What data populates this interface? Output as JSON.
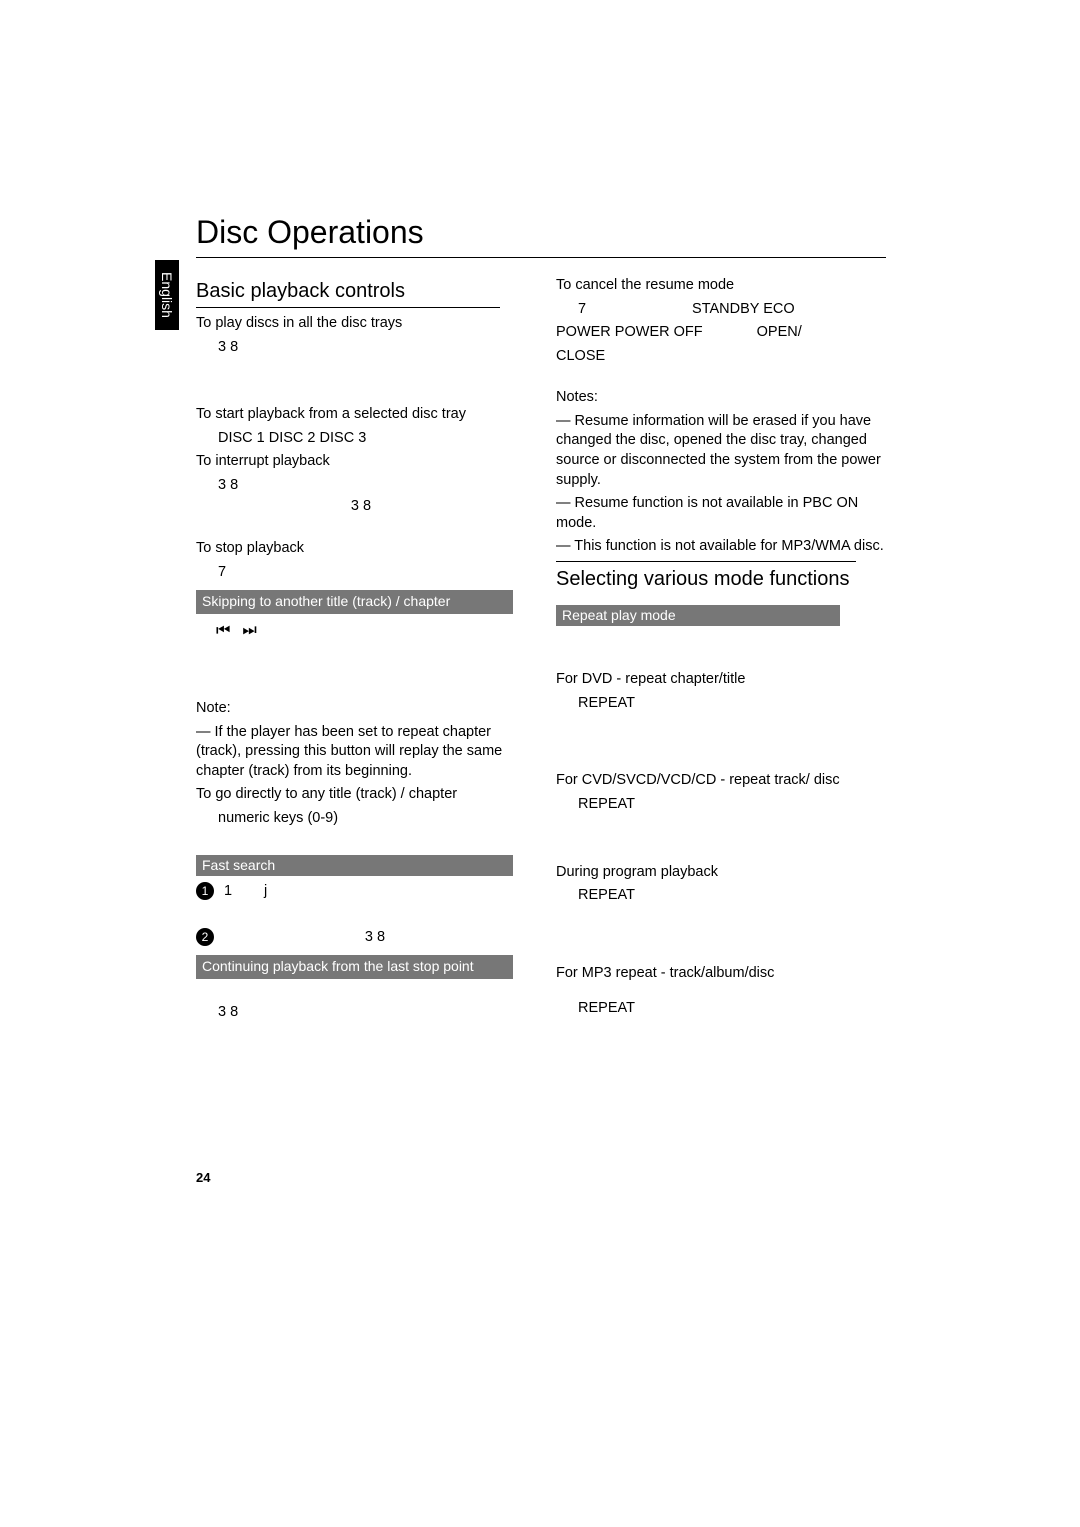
{
  "lang_tab": "English",
  "title": "Disc Operations",
  "page_number": "24",
  "left": {
    "h_basic": "Basic playback controls",
    "play_all_label": "To play discs in all the disc trays",
    "play_all_val": "3 8",
    "start_tray_label": "To start playback from a selected disc tray",
    "start_tray_val": "DISC 1  DISC 2     DISC 3",
    "interrupt_label": "To interrupt playback",
    "interrupt_val1": "3 8",
    "interrupt_val2": "3 8",
    "stop_label": "To stop playback",
    "stop_val": "7",
    "bar_skip": "Skipping to another title (track) / chapter",
    "icons": "⏮  ⏭",
    "note_label": "Note:",
    "note_body": "— If the player has been set to repeat chapter (track), pressing this button will replay the same chapter (track) from its beginning.",
    "goto_label": "To go directly to any title (track) / chapter",
    "goto_val": "numeric keys (0-9)",
    "bar_fast": "Fast search",
    "step1_a": "1",
    "step1_b": "j",
    "step2": "3 8",
    "bar_cont": "Continuing playback from the last stop point",
    "cont_val": "3 8"
  },
  "right": {
    "cancel_label": "To cancel the resume mode",
    "cancel_line1_a": "7",
    "cancel_line1_b": "STANDBY   ECO",
    "cancel_line2_a": "POWER  POWER OFF",
    "cancel_line2_b": "OPEN/",
    "cancel_line3": "CLOSE",
    "notes_label": "Notes:",
    "note1": "— Resume information will be erased if you have changed the disc, opened the disc tray, changed source or disconnected the system from the power supply.",
    "note2": "— Resume function is not available in PBC ON mode.",
    "note3": "— This function is not available for MP3/WMA disc.",
    "h_select": "Selecting various mode functions",
    "bar_repeat": "Repeat play mode",
    "dvd_label": "For DVD - repeat chapter/title",
    "dvd_val": "REPEAT",
    "cvd_label": "For CVD/SVCD/VCD/CD - repeat track/ disc",
    "cvd_val": "REPEAT",
    "prog_label": "During program playback",
    "prog_val": "REPEAT",
    "mp3_label": "For MP3 repeat - track/album/disc",
    "mp3_val": "REPEAT"
  }
}
